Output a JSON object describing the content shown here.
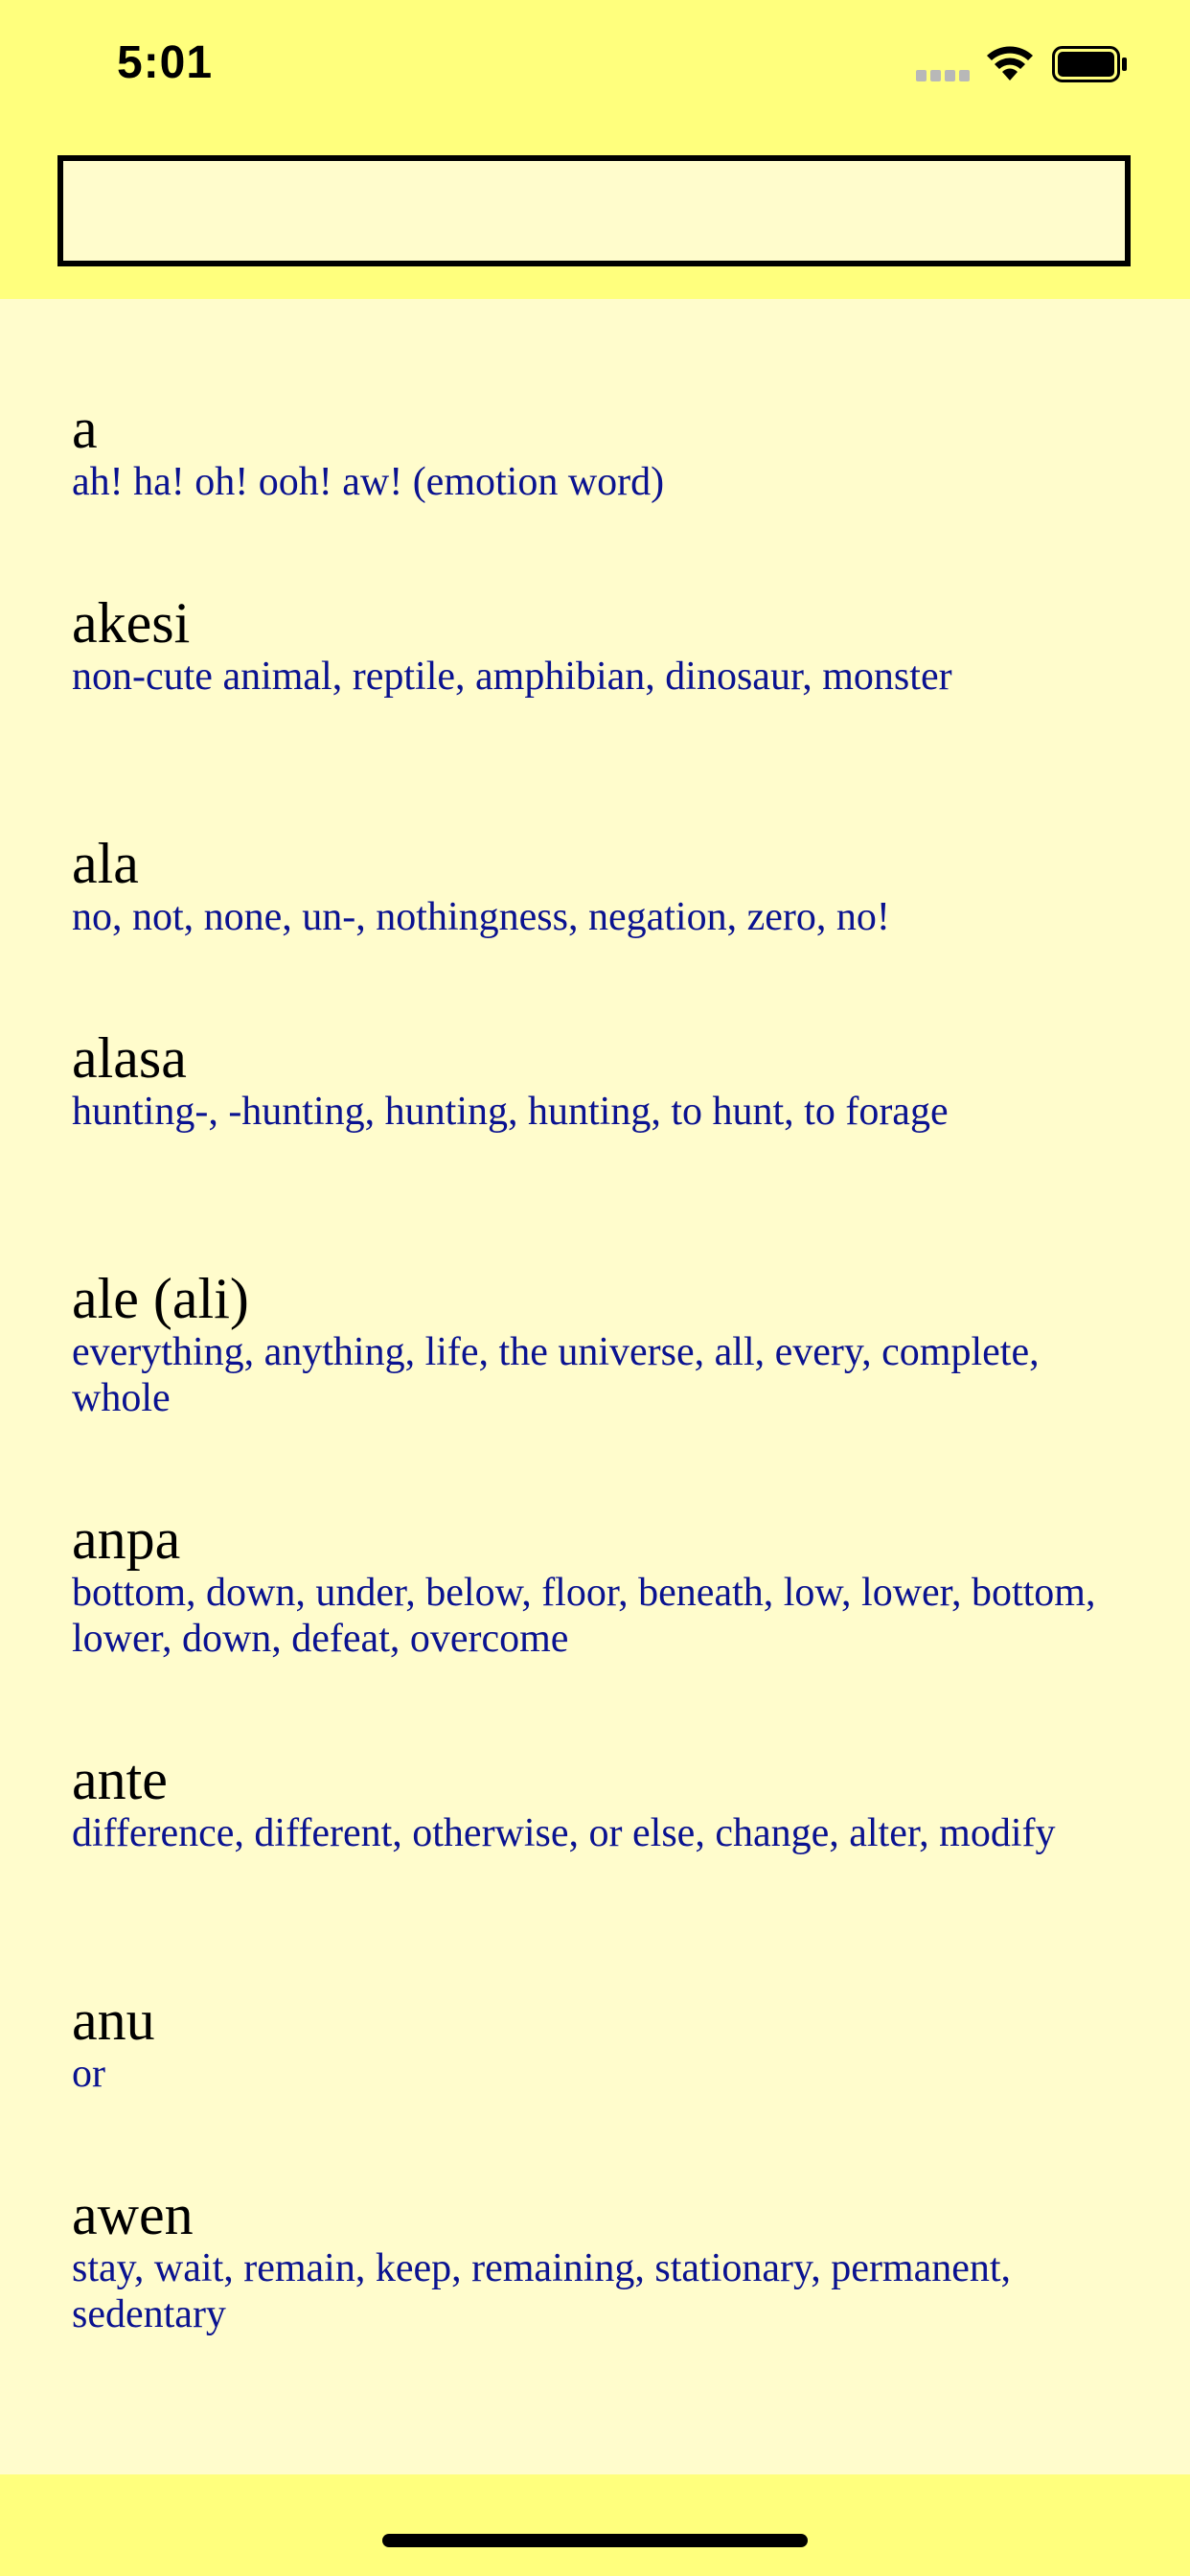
{
  "status_bar": {
    "time": "5:01",
    "signal_icon": "cellular-signal-icon",
    "wifi_icon": "wifi-icon",
    "battery_icon": "battery-icon"
  },
  "search": {
    "value": "",
    "placeholder": ""
  },
  "entries": [
    {
      "word": "a",
      "definition": "ah! ha! oh! ooh! aw! (emotion word)"
    },
    {
      "word": "akesi",
      "definition": "non-cute animal, reptile, amphibian, dinosaur, monster"
    },
    {
      "word": "ala",
      "definition": "no, not, none, un-, nothingness, negation, zero, no!"
    },
    {
      "word": "alasa",
      "definition": "hunting-, -hunting, hunting, hunting, to hunt, to forage"
    },
    {
      "word": "ale (ali)",
      "definition": "everything, anything, life, the universe, all, every, complete, whole"
    },
    {
      "word": "anpa",
      "definition": "bottom, down, under, below, floor, beneath, low, lower, bottom, lower, down, defeat, overcome"
    },
    {
      "word": "ante",
      "definition": "difference, different, otherwise, or else, change, alter, modify"
    },
    {
      "word": "anu",
      "definition": "or"
    },
    {
      "word": "awen",
      "definition": "stay, wait, remain, keep, remaining, stationary, permanent, sedentary"
    }
  ],
  "colors": {
    "header_background": "#ffff7d",
    "list_background": "#fffccc",
    "word_color": "#000000",
    "definition_color": "#0a1290"
  }
}
